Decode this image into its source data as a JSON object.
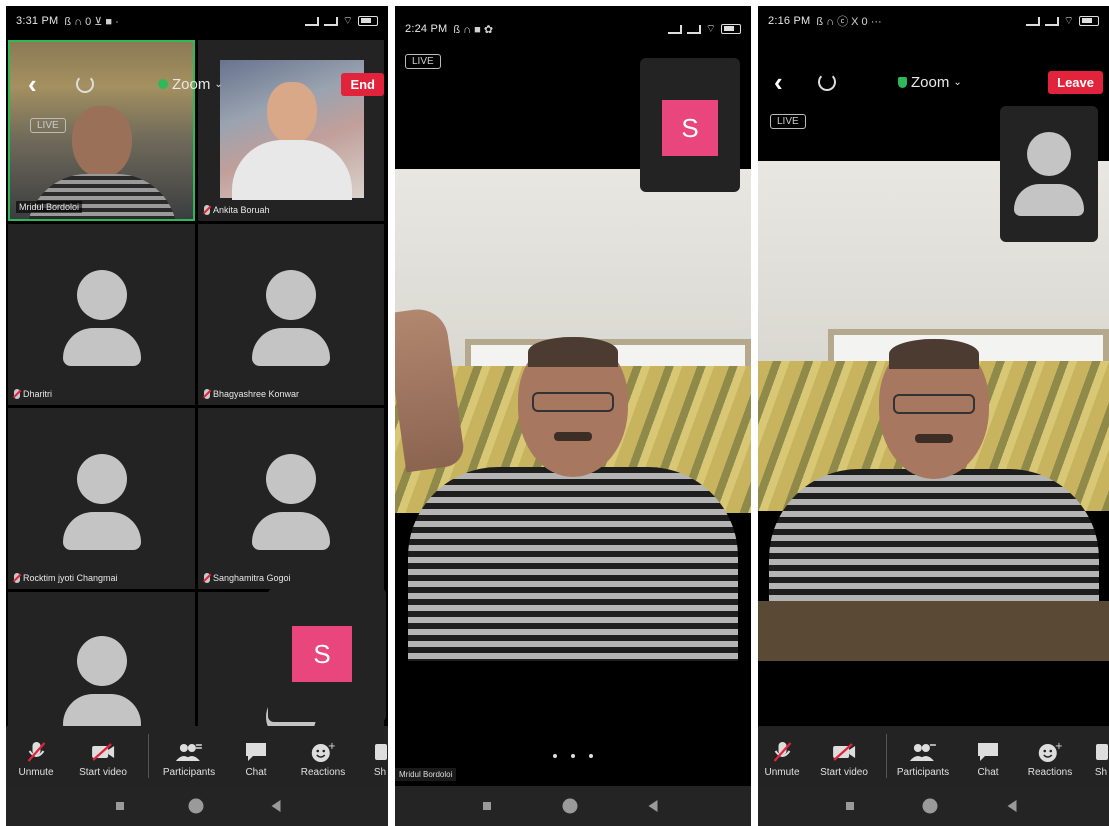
{
  "phone1": {
    "status": {
      "time": "3:31 PM",
      "icons": "ß ∩ 0 ⊻ ■ ·"
    },
    "title": "Zoom",
    "end_label": "End",
    "live_label": "LIVE",
    "self_initial": "S",
    "participants": [
      {
        "name": "Mridul Bordoloi",
        "video": true
      },
      {
        "name": "Ankita Boruah",
        "video": true
      },
      {
        "name": "Dharitri",
        "video": false
      },
      {
        "name": "Bhagyashree Konwar",
        "video": false
      },
      {
        "name": "Rocktim jyoti Changmai",
        "video": false
      },
      {
        "name": "Sanghamitra Gogoi",
        "video": false
      }
    ],
    "toolbar": {
      "unmute": "Unmute",
      "start_video": "Start video",
      "participants": "Participants",
      "chat": "Chat",
      "reactions": "Reactions",
      "share": "Sh"
    }
  },
  "phone2": {
    "status": {
      "time": "2:24 PM",
      "icons": "ß ∩ ■ ✿"
    },
    "live_label": "LIVE",
    "self_initial": "S",
    "speaker_name": "Mridul Bordoloi"
  },
  "phone3": {
    "status": {
      "time": "2:16 PM",
      "icons": "ß ∩ ⓒ X 0 ···"
    },
    "title": "Zoom",
    "leave_label": "Leave",
    "live_label": "LIVE",
    "toolbar": {
      "unmute": "Unmute",
      "start_video": "Start video",
      "participants": "Participants",
      "chat": "Chat",
      "reactions": "Reactions",
      "share": "Sh"
    }
  },
  "colors": {
    "end_red": "#e2233c",
    "self_pink": "#e8467d",
    "tile_bg": "#232323",
    "active_border": "#2db85a"
  }
}
